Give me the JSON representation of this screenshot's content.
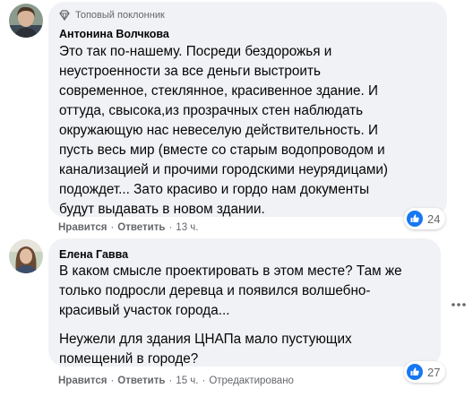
{
  "comments": [
    {
      "badge": "Топовый поклонник",
      "author": "Антонина Волчкова",
      "lines": [
        "Это так по-нашему. Посреди бездорожья и",
        "неустроенности за все деньги выстроить",
        "современное, стеклянное, красивенное здание. И",
        "оттуда, свысока,из прозрачных стен наблюдать",
        "окружающую нас невеселую действительность. И",
        "пусть весь мир (вместе со старым водопроводом и",
        "канализацией и прочими городскими неурядицами)",
        "подождет... Зато красиво и гордо нам документы",
        "будут выдавать в новом здании."
      ],
      "like_label": "Нравится",
      "reply_label": "Ответить",
      "separator": "·",
      "time": "13 ч.",
      "reaction_count": "24",
      "reaction_icon": "like-icon",
      "colors": {
        "like": "#1877f2",
        "love": "#f33e58"
      }
    },
    {
      "author": "Елена Гавва",
      "paragraph1": [
        "В каком смысле проектировать в этом месте? Там же",
        "только подросли деревца и появился волшебно-",
        "красивый участок города..."
      ],
      "paragraph2": [
        "Неужели для здания ЦНАПа мало пустующих",
        "помещений в городе?"
      ],
      "like_label": "Нравится",
      "reply_label": "Ответить",
      "separator": "·",
      "time": "15 ч.",
      "edited": "Отредактировано",
      "reaction_count": "27",
      "reaction_icon": "like-icon",
      "more_icon": "more-options-icon"
    }
  ]
}
